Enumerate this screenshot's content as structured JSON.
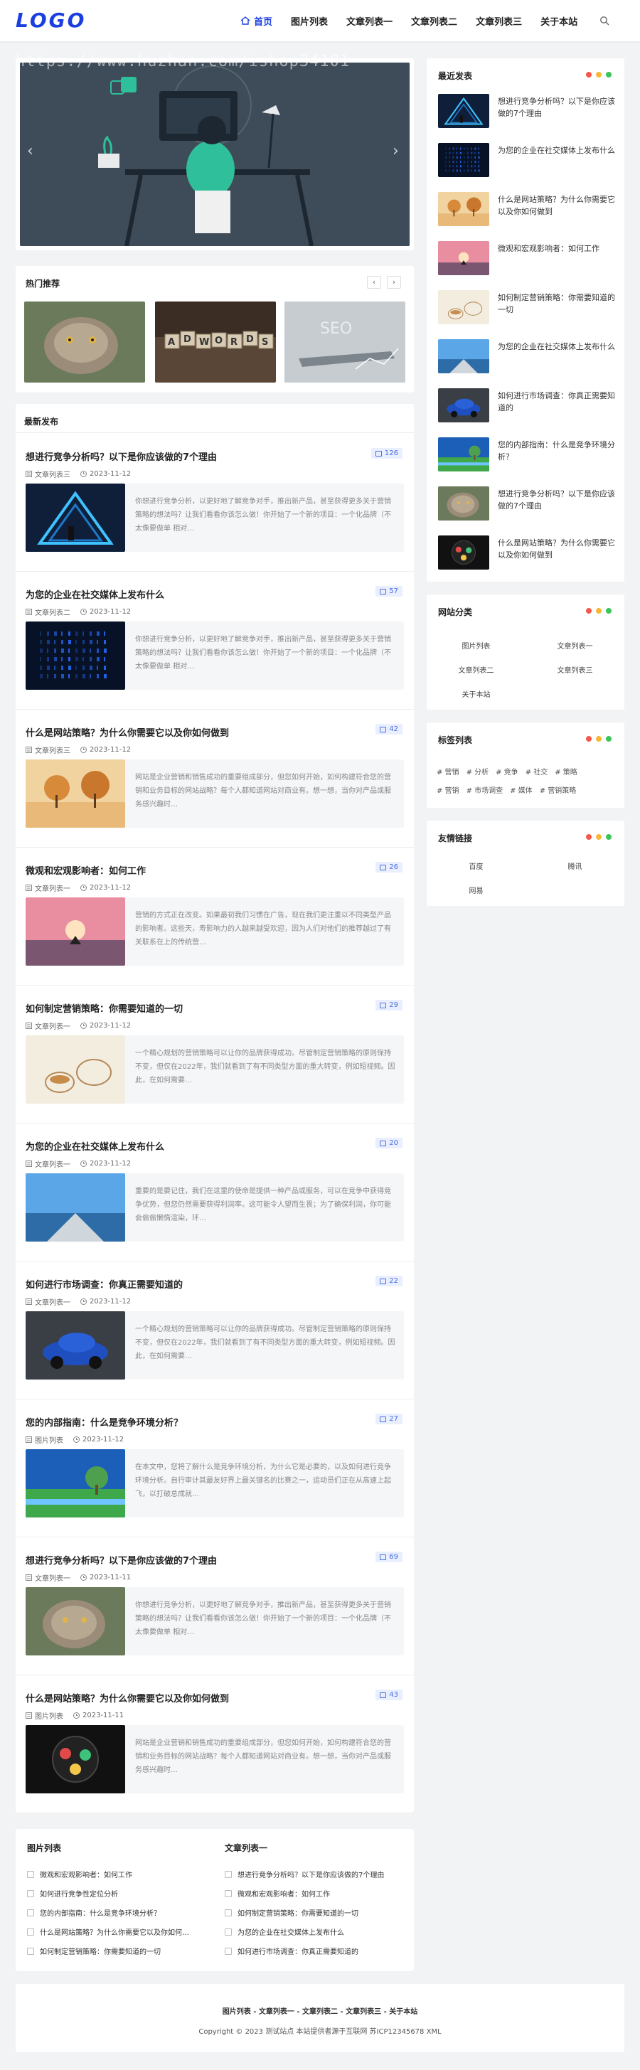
{
  "header": {
    "logo": "LOGO",
    "nav": [
      "首页",
      "图片列表",
      "文章列表一",
      "文章列表二",
      "文章列表三",
      "关于本站"
    ]
  },
  "watermark": "https://www.huzhan.com/ishop34101",
  "hot": {
    "title": "热门推荐",
    "prev": "‹",
    "next": "›",
    "images": [
      "cat-photo",
      "adwords-blocks-photo",
      "seo-laptop-photo"
    ]
  },
  "latest": {
    "title": "最新发布",
    "posts": [
      {
        "title": "想进行竞争分析吗？以下是你应该做的7个理由",
        "count": "126",
        "category": "文章列表三",
        "date": "2023-11-12",
        "excerpt": "你想进行竞争分析，以更好地了解竞争对手，推出新产品，甚至获得更多关于营销策略的想法吗？让我们看看你该怎么做！你开始了一个新的项目：一个化品牌（不太像要做单 相对…"
      },
      {
        "title": "为您的企业在社交媒体上发布什么",
        "count": "57",
        "category": "文章列表二",
        "date": "2023-11-12",
        "excerpt": "你想进行竞争分析，以更好地了解竞争对手，推出新产品，甚至获得更多关于营销策略的想法吗？让我们看看你该怎么做！你开始了一个新的项目：一个化品牌（不太像要做单 相对…"
      },
      {
        "title": "什么是网站策略？为什么你需要它以及你如何做到",
        "count": "42",
        "category": "文章列表三",
        "date": "2023-11-12",
        "excerpt": "网站是企业营销和销售成功的重要组成部分，但您如何开始，如何构建符合您的营销和业务目标的网站战略？每个人都知道网站对商业有。想一想，当你对产品或服务感兴趣时…"
      },
      {
        "title": "微观和宏观影响者：如何工作",
        "count": "26",
        "category": "文章列表一",
        "date": "2023-11-12",
        "excerpt": "营销的方式正在改变。如果最初我们习惯在广告，现在我们更注重以不同类型产品的影响者。这些天，寿影响力的人越来越受欢迎，因为人们对他们的推荐越过了有关联系在上的传统营…"
      },
      {
        "title": "如何制定营销策略：你需要知道的一切",
        "count": "29",
        "category": "文章列表一",
        "date": "2023-11-12",
        "excerpt": "一个精心规划的营销策略可以让你的品牌获得成功。尽管制定营销策略的原则保持不变，但仅在2022年，我们就看到了有不同类型方面的重大转变，例如短视频。因此，在如何需要…"
      },
      {
        "title": "为您的企业在社交媒体上发布什么",
        "count": "20",
        "category": "文章列表一",
        "date": "2023-11-12",
        "excerpt": "重要的是要记住，我们在这里的使命是提供一种产品或服务，可以在竞争中获得竞争优势，但您仍然需要获得利润率。这可能令人望而生畏；为了确保利润，你可能会偷偷懒惰渲染，环…"
      },
      {
        "title": "如何进行市场调查：你真正需要知道的",
        "count": "22",
        "category": "文章列表一",
        "date": "2023-11-12",
        "excerpt": "一个精心规划的营销策略可以让你的品牌获得成功。尽管制定营销策略的原则保持不变，但仅在2022年，我们就看到了有不同类型方面的重大转变，例如短视频。因此，在如何需要…"
      },
      {
        "title": "您的内部指南：什么是竞争环境分析？",
        "count": "27",
        "category": "图片列表",
        "date": "2023-11-12",
        "excerpt": "在本文中，您将了解什么是竞争环境分析，为什么它是必要的，以及如何进行竞争环境分析。自行审计其最友好界上最关键名的比赛之一，运动员们正在从高速上起飞，以打破总成就…"
      },
      {
        "title": "想进行竞争分析吗？以下是你应该做的7个理由",
        "count": "69",
        "category": "文章列表一",
        "date": "2023-11-11",
        "excerpt": "你想进行竞争分析，以更好地了解竞争对手，推出新产品，甚至获得更多关于营销策略的想法吗？让我们看看你该怎么做！你开始了一个新的项目：一个化品牌（不太像要做单 相对…"
      },
      {
        "title": "什么是网站策略？为什么你需要它以及你如何做到",
        "count": "43",
        "category": "图片列表",
        "date": "2023-11-11",
        "excerpt": "网站是企业营销和销售成功的重要组成部分，但您如何开始，如何构建符合您的营销和业务目标的网站战略？每个人都知道网站对商业有。想一想，当你对产品或服务感兴趣时…"
      }
    ]
  },
  "recent": {
    "title": "最近发表",
    "items": [
      "想进行竞争分析吗？以下是你应该做的7个理由",
      "为您的企业在社交媒体上发布什么",
      "什么是网站策略？为什么你需要它以及你如何做到",
      "微观和宏观影响者：如何工作",
      "如何制定营销策略：你需要知道的一切",
      "为您的企业在社交媒体上发布什么",
      "如何进行市场调查：你真正需要知道的",
      "您的内部指南：什么是竞争环境分析？",
      "想进行竞争分析吗？以下是你应该做的7个理由",
      "什么是网站策略？为什么你需要它以及你如何做到"
    ]
  },
  "categories": {
    "title": "网站分类",
    "items": [
      "图片列表",
      "文章列表一",
      "文章列表二",
      "文章列表三",
      "关于本站"
    ]
  },
  "tags": {
    "title": "标签列表",
    "items": [
      "# 营销",
      "# 分析",
      "# 竞争",
      "# 社交",
      "# 策略",
      "# 营销",
      "# 市场调查",
      "# 媒体",
      "# 营销策略"
    ]
  },
  "links": {
    "title": "友情链接",
    "items": [
      "百度",
      "腾讯",
      "网易"
    ]
  },
  "bottom": {
    "left_title": "图片列表",
    "left_items": [
      "微观和宏观影响者：如何工作",
      "如何进行竞争性定位分析",
      "您的内部指南：什么是竞争环境分析？",
      "什么是网站策略？为什么你需要它以及你如何…",
      "如何制定营销策略：你需要知道的一切"
    ],
    "right_title": "文章列表一",
    "right_items": [
      "想进行竞争分析吗？以下是你应该做的7个理由",
      "微观和宏观影响者：如何工作",
      "如何制定营销策略：你需要知道的一切",
      "为您的企业在社交媒体上发布什么",
      "如何进行市场调查：你真正需要知道的"
    ]
  },
  "footer": {
    "links": "图片列表 - 文章列表一 - 文章列表二 - 文章列表三 - 关于本站",
    "copyright": "Copyright © 2023 测试站点 本站提供者源于互联网 苏ICP12345678 XML"
  },
  "colors": {
    "brand": "#1a3fe0",
    "dot_red": "#f4584a",
    "dot_yellow": "#f5b83a",
    "dot_green": "#3dc45a"
  }
}
